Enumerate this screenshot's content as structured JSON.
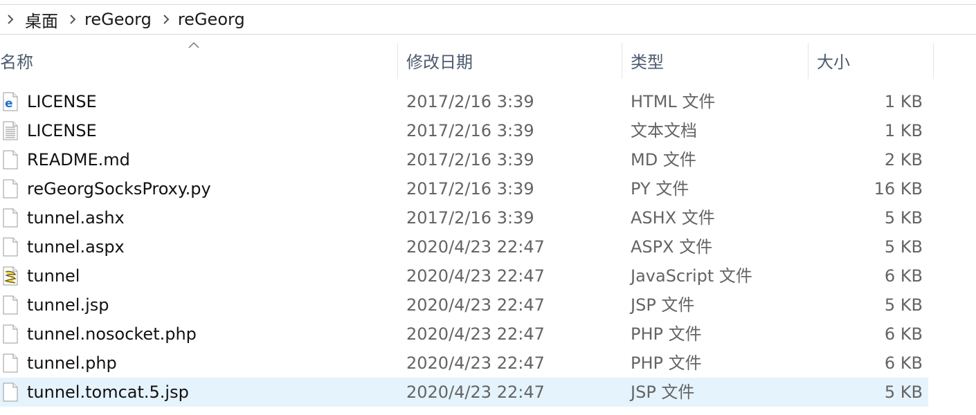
{
  "breadcrumb": {
    "items": [
      "桌面",
      "reGeorg",
      "reGeorg"
    ]
  },
  "columns": {
    "name": "名称",
    "modified": "修改日期",
    "type": "类型",
    "size": "大小",
    "sorted_by": "name"
  },
  "files": [
    {
      "name": "LICENSE",
      "modified": "2017/2/16 3:39",
      "type": "HTML 文件",
      "size": "1 KB",
      "icon": "html-file-icon"
    },
    {
      "name": "LICENSE",
      "modified": "2017/2/16 3:39",
      "type": "文本文档",
      "size": "1 KB",
      "icon": "text-file-icon"
    },
    {
      "name": "README.md",
      "modified": "2017/2/16 3:39",
      "type": "MD 文件",
      "size": "2 KB",
      "icon": "blank-file-icon"
    },
    {
      "name": "reGeorgSocksProxy.py",
      "modified": "2017/2/16 3:39",
      "type": "PY 文件",
      "size": "16 KB",
      "icon": "blank-file-icon"
    },
    {
      "name": "tunnel.ashx",
      "modified": "2017/2/16 3:39",
      "type": "ASHX 文件",
      "size": "5 KB",
      "icon": "blank-file-icon"
    },
    {
      "name": "tunnel.aspx",
      "modified": "2020/4/23 22:47",
      "type": "ASPX 文件",
      "size": "5 KB",
      "icon": "blank-file-icon"
    },
    {
      "name": "tunnel",
      "modified": "2020/4/23 22:47",
      "type": "JavaScript 文件",
      "size": "6 KB",
      "icon": "script-file-icon"
    },
    {
      "name": "tunnel.jsp",
      "modified": "2020/4/23 22:47",
      "type": "JSP 文件",
      "size": "5 KB",
      "icon": "blank-file-icon"
    },
    {
      "name": "tunnel.nosocket.php",
      "modified": "2020/4/23 22:47",
      "type": "PHP 文件",
      "size": "6 KB",
      "icon": "blank-file-icon"
    },
    {
      "name": "tunnel.php",
      "modified": "2020/4/23 22:47",
      "type": "PHP 文件",
      "size": "6 KB",
      "icon": "blank-file-icon"
    },
    {
      "name": "tunnel.tomcat.5.jsp",
      "modified": "2020/4/23 22:47",
      "type": "JSP 文件",
      "size": "5 KB",
      "icon": "blank-file-icon",
      "selected": true
    }
  ],
  "colors": {
    "selection": "#e5f3fd",
    "header_text": "#4c5b6e",
    "secondary_text": "#646464"
  }
}
